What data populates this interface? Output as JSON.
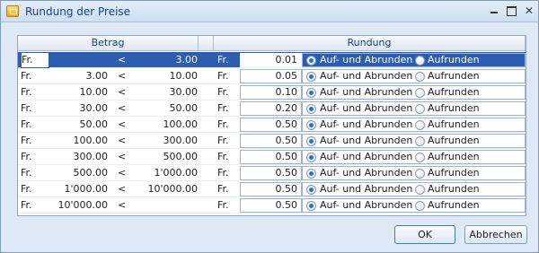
{
  "window": {
    "title": "Rundung der Preise"
  },
  "header": {
    "betrag": "Betrag",
    "rundung": "Rundung"
  },
  "rows": [
    {
      "fr1": "Fr.",
      "from": "",
      "lt": "<",
      "to": "3.00",
      "fr2": "Fr.",
      "value": "0.01",
      "opt1": "Auf- und Abrunden",
      "opt2": "Aufrunden",
      "selected": true
    },
    {
      "fr1": "Fr.",
      "from": "3.00",
      "lt": "<",
      "to": "10.00",
      "fr2": "Fr.",
      "value": "0.05",
      "opt1": "Auf- und Abrunden",
      "opt2": "Aufrunden"
    },
    {
      "fr1": "Fr.",
      "from": "10.00",
      "lt": "<",
      "to": "30.00",
      "fr2": "Fr.",
      "value": "0.10",
      "opt1": "Auf- und Abrunden",
      "opt2": "Aufrunden"
    },
    {
      "fr1": "Fr.",
      "from": "30.00",
      "lt": "<",
      "to": "50.00",
      "fr2": "Fr.",
      "value": "0.20",
      "opt1": "Auf- und Abrunden",
      "opt2": "Aufrunden"
    },
    {
      "fr1": "Fr.",
      "from": "50.00",
      "lt": "<",
      "to": "100.00",
      "fr2": "Fr.",
      "value": "0.50",
      "opt1": "Auf- und Abrunden",
      "opt2": "Aufrunden"
    },
    {
      "fr1": "Fr.",
      "from": "100.00",
      "lt": "<",
      "to": "300.00",
      "fr2": "Fr.",
      "value": "0.50",
      "opt1": "Auf- und Abrunden",
      "opt2": "Aufrunden"
    },
    {
      "fr1": "Fr.",
      "from": "300.00",
      "lt": "<",
      "to": "500.00",
      "fr2": "Fr.",
      "value": "0.50",
      "opt1": "Auf- und Abrunden",
      "opt2": "Aufrunden"
    },
    {
      "fr1": "Fr.",
      "from": "500.00",
      "lt": "<",
      "to": "1'000.00",
      "fr2": "Fr.",
      "value": "0.50",
      "opt1": "Auf- und Abrunden",
      "opt2": "Aufrunden"
    },
    {
      "fr1": "Fr.",
      "from": "1'000.00",
      "lt": "<",
      "to": "10'000.00",
      "fr2": "Fr.",
      "value": "0.50",
      "opt1": "Auf- und Abrunden",
      "opt2": "Aufrunden"
    },
    {
      "fr1": "Fr.",
      "from": "10'000.00",
      "lt": "<",
      "to": "",
      "fr2": "Fr.",
      "value": "0.50",
      "opt1": "Auf- und Abrunden",
      "opt2": "Aufrunden"
    }
  ],
  "buttons": {
    "ok": "OK",
    "cancel": "Abbrechen"
  },
  "colors": {
    "selection": "#2c5daf",
    "title_text": "#15428b",
    "radio_selected": "#2a72c6"
  }
}
